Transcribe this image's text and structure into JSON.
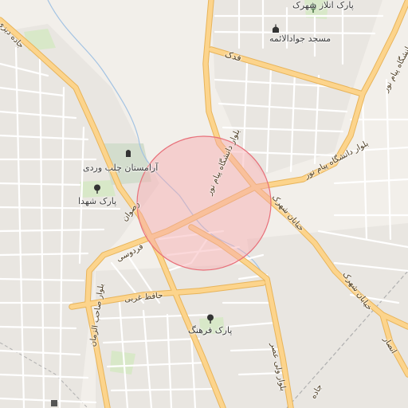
{
  "map": {
    "labels": {
      "park_atlas": "پارک اتلاز شهرک",
      "mosque": "مسجد جوادالائمه",
      "fadak": "فدک",
      "payam_noor_ne": "بلوار دانشگاه پیام نور",
      "payam_noor_center": "بلوار دانشگاه پیام نور",
      "jade_dizi": "جاده دیزی",
      "cemetery": "آرامستان چلب وردی",
      "park_shohada": "پارک شهدا",
      "rezvan": "رضوان",
      "ferdowsi": "فردوسی",
      "khayaban_shahrak": "خیابان شهرک",
      "khayaban_shahrak_2": "خیابان شهرک",
      "hafez_gharbi": "حافظ غربی",
      "park_farhang": "پارک فرهنگ",
      "sahib_zaman": "بلوار صاحب الزمان",
      "vali_asr": "بلوار ولی عصر",
      "ansar": "انصار",
      "road_bottom": "جاده"
    },
    "colors": {
      "background": "#f2efea",
      "major_road": "#fcd48c",
      "major_road_casing": "#e8b45a",
      "minor_road": "#ffffff",
      "minor_road_casing": "#d6d2cc",
      "park": "#d8e8c8",
      "cemetery": "#d3ddcd",
      "stream": "#a3c3e3",
      "railway": "#9a9a9a",
      "highlight_fill": "#f7a8ae",
      "highlight_stroke": "#e8707a"
    },
    "icons": [
      "park-icon",
      "mosque-icon",
      "cemetery-icon",
      "park-icon",
      "park-icon",
      "place-icon"
    ]
  }
}
